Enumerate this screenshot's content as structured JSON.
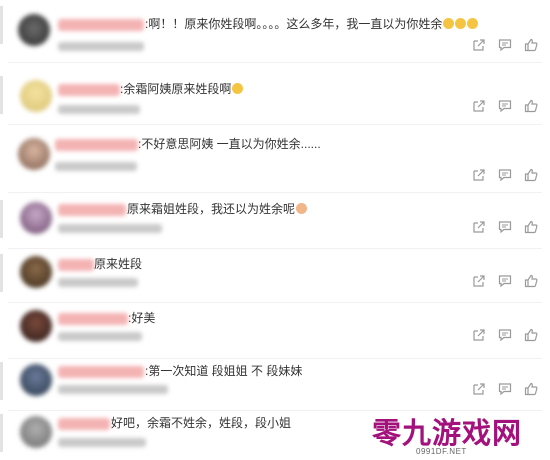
{
  "comments": [
    {
      "text": ":啊！！原来你姓段啊。。。。这么多年，我一直以为你姓余",
      "emojis": 3
    },
    {
      "text": ":余霜阿姨原来姓段啊",
      "emojis": 1
    },
    {
      "text": ":不好意思阿姨 一直以为你姓余......",
      "emojis": 0
    },
    {
      "text": "原来霜姐姓段，我还以为姓余呢",
      "emojis": 1
    },
    {
      "text": "原来姓段",
      "emojis": 0
    },
    {
      "text": ":好美",
      "emojis": 0
    },
    {
      "text": ":第一次知道 段姐姐 不 段妹妹",
      "emojis": 0
    },
    {
      "text": "好吧，余霜不姓余，姓段，段小姐",
      "emojis": 0
    }
  ],
  "icons": {
    "share": "share-icon",
    "reply": "reply-icon",
    "like": "like-icon"
  },
  "watermark": {
    "title": "零九游戏网",
    "url": "0991DF.NET"
  },
  "colors": {
    "username": "#f0a0a0",
    "meta": "#c9c9c9",
    "icon": "#9a9a9a",
    "watermark": "#a3127c"
  }
}
